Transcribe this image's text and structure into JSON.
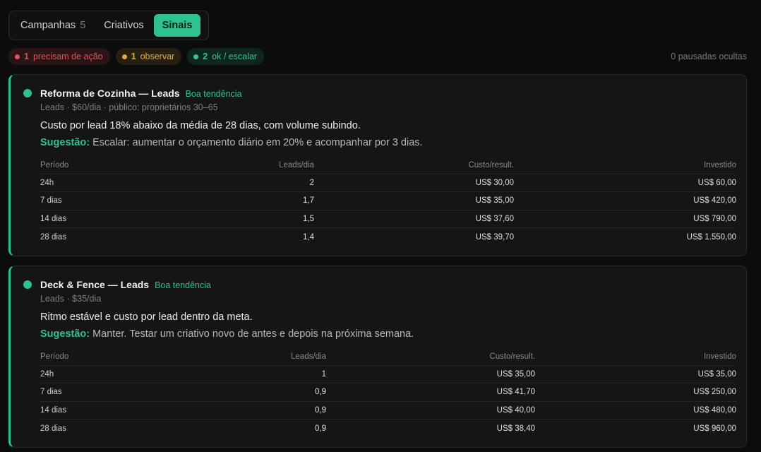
{
  "tabs": [
    {
      "label": "Campanhas",
      "count": "5"
    },
    {
      "label": "Criativos",
      "count": ""
    },
    {
      "label": "Sinais",
      "count": ""
    }
  ],
  "filters": {
    "action": {
      "count": "1",
      "label": "precisam de ação",
      "color": "#e2535a"
    },
    "watch": {
      "count": "1",
      "label": "observar",
      "color": "#e4ad3b"
    },
    "ok": {
      "count": "2",
      "label": "ok / escalar",
      "color": "#33c48f"
    }
  },
  "hidden_paused": "0 pausadas ocultas",
  "columns": {
    "period": "Período",
    "leads": "Leads/dia",
    "cost": "Custo/result.",
    "spent": "Investido"
  },
  "campaigns": [
    {
      "title": "Reforma de Cozinha — Leads",
      "trend": "Boa tendência",
      "meta": "Leads · $60/dia · público: proprietários 30–65",
      "summary": "Custo por lead 18% abaixo da média de 28 dias, com volume subindo.",
      "suggestion_label": "Sugestão:",
      "suggestion": "Escalar: aumentar o orçamento diário em 20% e acompanhar por 3 dias.",
      "rows": [
        {
          "period": "24h",
          "leads": "2",
          "cost": "US$ 30,00",
          "spent": "US$ 60,00"
        },
        {
          "period": "7 dias",
          "leads": "1,7",
          "cost": "US$ 35,00",
          "spent": "US$ 420,00"
        },
        {
          "period": "14 dias",
          "leads": "1,5",
          "cost": "US$ 37,60",
          "spent": "US$ 790,00"
        },
        {
          "period": "28 dias",
          "leads": "1,4",
          "cost": "US$ 39,70",
          "spent": "US$ 1.550,00"
        }
      ]
    },
    {
      "title": "Deck & Fence — Leads",
      "trend": "Boa tendência",
      "meta": "Leads · $35/dia",
      "summary": "Ritmo estável e custo por lead dentro da meta.",
      "suggestion_label": "Sugestão:",
      "suggestion": "Manter. Testar um criativo novo de antes e depois na próxima semana.",
      "rows": [
        {
          "period": "24h",
          "leads": "1",
          "cost": "US$ 35,00",
          "spent": "US$ 35,00"
        },
        {
          "period": "7 dias",
          "leads": "0,9",
          "cost": "US$ 41,70",
          "spent": "US$ 250,00"
        },
        {
          "period": "14 dias",
          "leads": "0,9",
          "cost": "US$ 40,00",
          "spent": "US$ 480,00"
        },
        {
          "period": "28 dias",
          "leads": "0,9",
          "cost": "US$ 38,40",
          "spent": "US$ 960,00"
        }
      ]
    }
  ]
}
